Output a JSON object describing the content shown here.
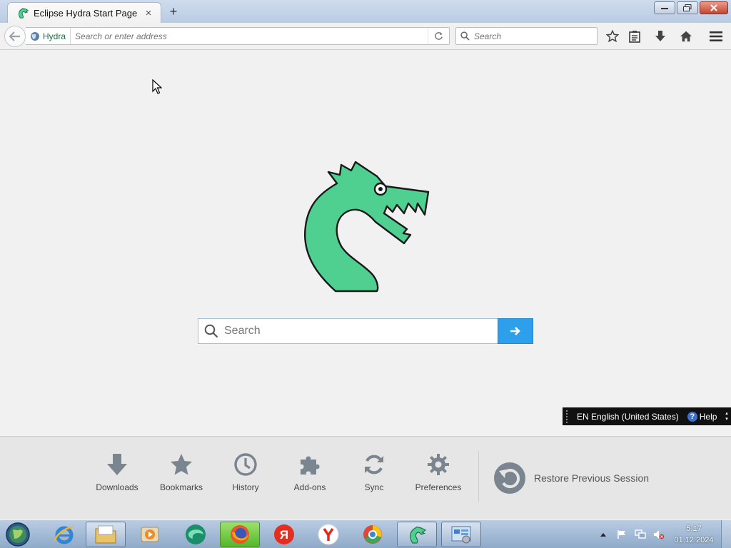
{
  "browser": {
    "tab": {
      "title": "Eclipse Hydra Start Page",
      "close_glyph": "×"
    },
    "new_tab_glyph": "+",
    "identity_label": "Hydra",
    "urlbar": {
      "placeholder": "Search or enter address",
      "value": ""
    },
    "searchbar": {
      "placeholder": "Search",
      "value": ""
    },
    "toolbar_icons": [
      "bookmark-star-icon",
      "reading-list-icon",
      "download-arrow-icon",
      "home-icon",
      "menu-hamburger-icon"
    ]
  },
  "content": {
    "search": {
      "placeholder": "Search",
      "value": ""
    },
    "accent": "#2e9fea",
    "logo_color": "#4fcf90"
  },
  "langbar": {
    "language": "EN English (United States)",
    "help": "Help"
  },
  "launcher": {
    "items": [
      {
        "label": "Downloads",
        "icon": "download-arrow-icon"
      },
      {
        "label": "Bookmarks",
        "icon": "star-icon"
      },
      {
        "label": "History",
        "icon": "clock-icon"
      },
      {
        "label": "Add-ons",
        "icon": "puzzle-icon"
      },
      {
        "label": "Sync",
        "icon": "sync-icon"
      },
      {
        "label": "Preferences",
        "icon": "gear-icon"
      }
    ],
    "restore_label": "Restore Previous Session"
  },
  "taskbar": {
    "apps": [
      "internet-explorer-icon",
      "file-explorer-icon",
      "media-player-icon",
      "edge-like-browser-icon",
      "firefox-icon",
      "yandex-y-icon",
      "yandex-browser-icon",
      "chromium-like-icon",
      "hydra-icon",
      "control-panel-icon"
    ],
    "clock": {
      "time": "5:17",
      "date": "01.12.2024"
    }
  }
}
